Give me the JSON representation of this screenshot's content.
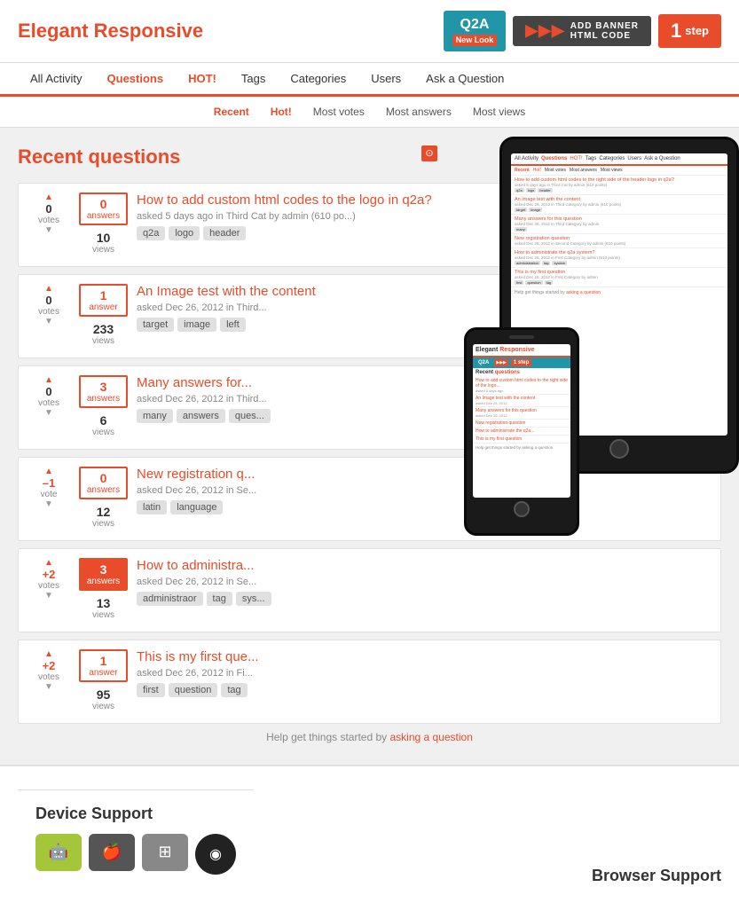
{
  "header": {
    "logo_text": "Elegant ",
    "logo_highlight": "Responsive",
    "q2a_badge": "Q2A",
    "q2a_sub": "New Look",
    "banner_text": "ADD BANNER\nHTML CODE",
    "step_label": "step",
    "step_num": "1"
  },
  "nav": {
    "items": [
      {
        "label": "All Activity",
        "href": "#",
        "active": false
      },
      {
        "label": "Questions",
        "href": "#",
        "active": true
      },
      {
        "label": "HOT!",
        "href": "#",
        "hot": true
      },
      {
        "label": "Tags",
        "href": "#"
      },
      {
        "label": "Categories",
        "href": "#"
      },
      {
        "label": "Users",
        "href": "#"
      },
      {
        "label": "Ask a Question",
        "href": "#"
      }
    ]
  },
  "sub_nav": {
    "items": [
      {
        "label": "Recent",
        "active": true
      },
      {
        "label": "Hot!",
        "href": "#"
      },
      {
        "label": "Most votes",
        "href": "#"
      },
      {
        "label": "Most answers",
        "href": "#"
      },
      {
        "label": "Most views",
        "href": "#"
      }
    ]
  },
  "page": {
    "title_prefix": "Recent ",
    "title_highlight": "questions"
  },
  "questions": [
    {
      "votes": 0,
      "vote_label": "votes",
      "answers": 0,
      "answer_label": "answers",
      "views": 10,
      "views_label": "views",
      "title": "How to add custom html codes to the logo in q2a?",
      "meta": "asked 5 days ago in Third Cat by admin (610 po...",
      "tags": [
        "q2a",
        "logo",
        "header"
      ]
    },
    {
      "votes": 0,
      "vote_label": "votes",
      "answers": 1,
      "answer_label": "answer",
      "views": 233,
      "views_label": "views",
      "title": "An Image test with the content",
      "meta": "asked Dec 26, 2012 in Third...",
      "tags": [
        "target",
        "image",
        "left"
      ]
    },
    {
      "votes": 0,
      "vote_label": "votes",
      "answers": 3,
      "answer_label": "answers",
      "views": 6,
      "views_label": "views",
      "title": "Many answers for...",
      "meta": "asked Dec 26, 2012 in Third...",
      "tags": [
        "many",
        "answers",
        "ques..."
      ]
    },
    {
      "votes": -1,
      "vote_label": "vote",
      "answers": 0,
      "answer_label": "answers",
      "views": 12,
      "views_label": "views",
      "title": "New registration q...",
      "meta": "asked Dec 26, 2012 in Se...",
      "tags": [
        "latin",
        "language"
      ]
    },
    {
      "votes": 2,
      "vote_label": "votes",
      "answers": 3,
      "answer_label": "answers",
      "views": 13,
      "views_label": "views",
      "title": "How to administra...",
      "meta": "asked Dec 26, 2012 in Se...",
      "tags": [
        "administraor",
        "tag",
        "sys..."
      ],
      "answers_highlighted": true
    },
    {
      "votes": 2,
      "vote_label": "votes",
      "answers": 1,
      "answer_label": "answer",
      "views": 95,
      "views_label": "views",
      "title": "This is my first que...",
      "meta": "asked Dec 26, 2012 in Fi...",
      "tags": [
        "first",
        "question",
        "tag"
      ]
    }
  ],
  "help_text": "Help get things started by",
  "help_link": "asking a question",
  "device_section": {
    "title": "Device Support"
  },
  "browser_section": {
    "title": "Browser Support"
  }
}
